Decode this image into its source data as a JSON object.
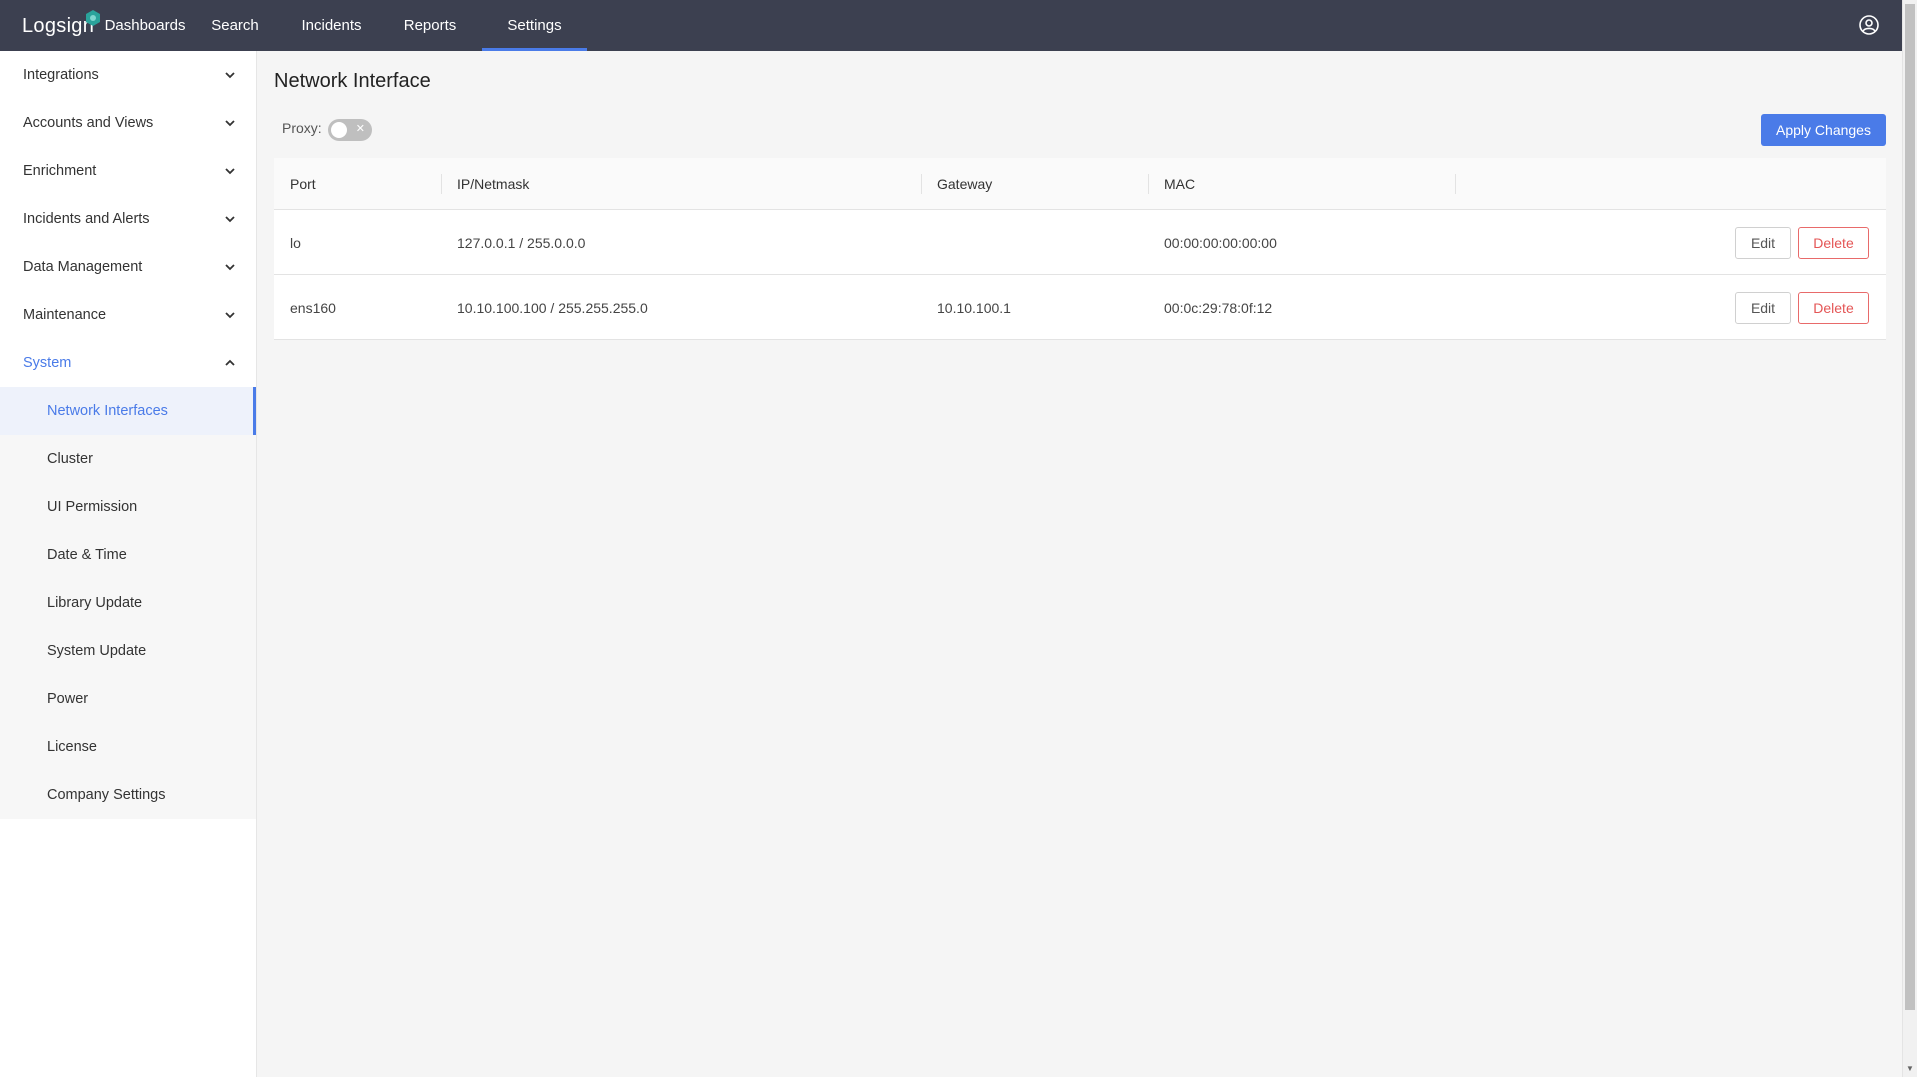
{
  "header": {
    "logo_text": "Logsign",
    "nav": [
      {
        "label": "Dashboards"
      },
      {
        "label": "Search"
      },
      {
        "label": "Incidents"
      },
      {
        "label": "Reports"
      },
      {
        "label": "Settings"
      }
    ],
    "active_nav": "Settings",
    "user_icon": "user-circle-icon"
  },
  "sidebar": {
    "groups": [
      {
        "label": "Integrations"
      },
      {
        "label": "Accounts and Views"
      },
      {
        "label": "Enrichment"
      },
      {
        "label": "Incidents and Alerts"
      },
      {
        "label": "Data Management"
      },
      {
        "label": "Maintenance"
      },
      {
        "label": "System"
      }
    ],
    "system_items": [
      {
        "label": "Network Interfaces"
      },
      {
        "label": "Cluster"
      },
      {
        "label": "UI Permission"
      },
      {
        "label": "Date & Time"
      },
      {
        "label": "Library Update"
      },
      {
        "label": "System Update"
      },
      {
        "label": "Power"
      },
      {
        "label": "License"
      },
      {
        "label": "Company Settings"
      }
    ],
    "active_item": "Network Interfaces"
  },
  "main": {
    "title": "Network Interface",
    "proxy_label": "Proxy:",
    "proxy_enabled": false,
    "apply_label": "Apply Changes",
    "columns": [
      "Port",
      "IP/Netmask",
      "Gateway",
      "MAC"
    ],
    "rows": [
      {
        "port": "lo",
        "ip": "127.0.0.1 / 255.0.0.0",
        "gateway": "",
        "mac": "00:00:00:00:00:00"
      },
      {
        "port": "ens160",
        "ip": "10.10.100.100 / 255.255.255.0",
        "gateway": "10.10.100.1",
        "mac": "00:0c:29:78:0f:12"
      }
    ],
    "edit_label": "Edit",
    "delete_label": "Delete"
  },
  "colors": {
    "topbar": "#3c4050",
    "accent": "#4a7be8",
    "danger": "#e45555"
  }
}
